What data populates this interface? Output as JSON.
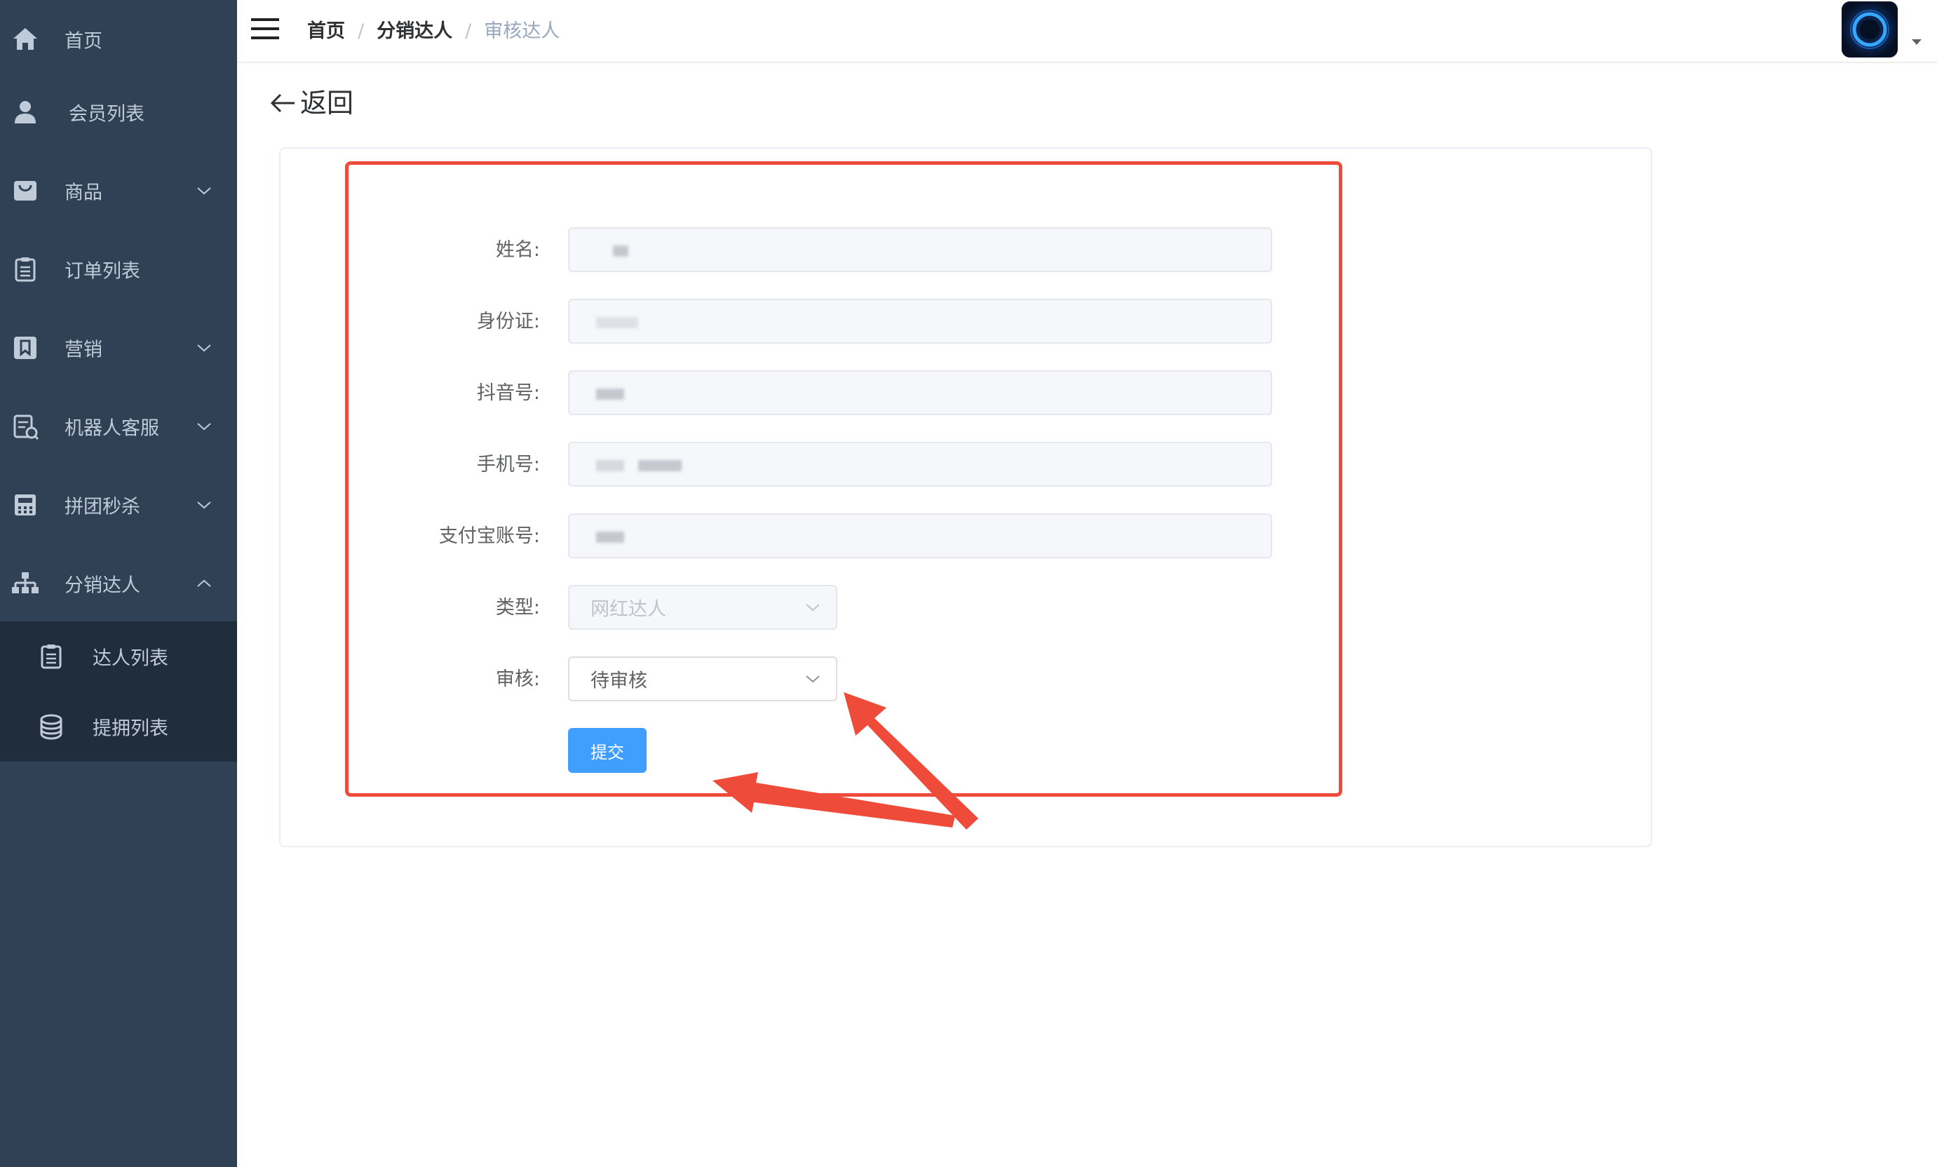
{
  "sidebar": {
    "items": [
      {
        "label": "首页",
        "icon": "home-icon"
      },
      {
        "label": "会员列表",
        "icon": "user-icon"
      },
      {
        "label": "商品",
        "icon": "shopping-bag-icon",
        "expandable": true
      },
      {
        "label": "订单列表",
        "icon": "clipboard-icon"
      },
      {
        "label": "营销",
        "icon": "bookmark-icon",
        "expandable": true
      },
      {
        "label": "机器人客服",
        "icon": "service-robot-icon",
        "expandable": true
      },
      {
        "label": "拼团秒杀",
        "icon": "calculator-icon",
        "expandable": true
      },
      {
        "label": "分销达人",
        "icon": "org-tree-icon",
        "expandable": true,
        "expanded": true
      }
    ],
    "subitems": [
      {
        "label": "达人列表",
        "icon": "clipboard-icon"
      },
      {
        "label": "提拥列表",
        "icon": "coins-icon"
      }
    ]
  },
  "header": {
    "breadcrumb": [
      "首页",
      "分销达人",
      "审核达人"
    ],
    "separator": "/"
  },
  "back_label": "返回",
  "form": {
    "fields": [
      {
        "label": "姓名:"
      },
      {
        "label": "身份证:"
      },
      {
        "label": "抖音号:"
      },
      {
        "label": "手机号:"
      },
      {
        "label": "支付宝账号:"
      }
    ],
    "type": {
      "label": "类型:",
      "value": "网红达人",
      "disabled": true
    },
    "review": {
      "label": "审核:",
      "value": "待审核"
    },
    "submit_label": "提交"
  },
  "colors": {
    "sidebar_bg": "#304156",
    "submenu_bg": "#1f2d3d",
    "sidebar_text": "#bfcbd9",
    "primary": "#409eff",
    "annotation": "#ef4b3a"
  }
}
